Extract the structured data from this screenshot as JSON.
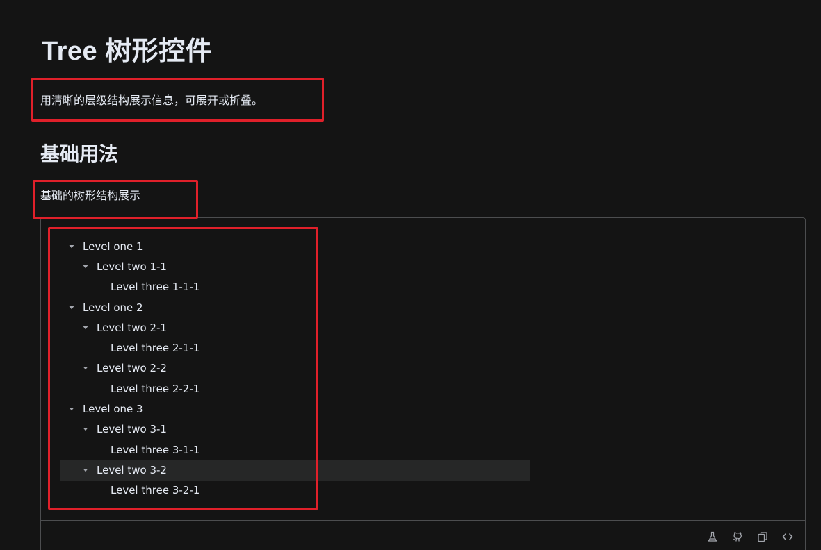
{
  "page": {
    "title": "Tree 树形控件",
    "description": "用清晰的层级结构展示信息，可展开或折叠。",
    "section_title": "基础用法",
    "section_description": "基础的树形结构展示"
  },
  "tree": {
    "nodes": [
      {
        "label": "Level one 1",
        "level": 1,
        "expanded": true
      },
      {
        "label": "Level two 1-1",
        "level": 2,
        "expanded": true
      },
      {
        "label": "Level three 1-1-1",
        "level": 3
      },
      {
        "label": "Level one 2",
        "level": 1,
        "expanded": true
      },
      {
        "label": "Level two 2-1",
        "level": 2,
        "expanded": true
      },
      {
        "label": "Level three 2-1-1",
        "level": 3
      },
      {
        "label": "Level two 2-2",
        "level": 2,
        "expanded": true
      },
      {
        "label": "Level three 2-2-1",
        "level": 3
      },
      {
        "label": "Level one 3",
        "level": 1,
        "expanded": true
      },
      {
        "label": "Level two 3-1",
        "level": 2,
        "expanded": true
      },
      {
        "label": "Level three 3-1-1",
        "level": 3
      },
      {
        "label": "Level two 3-2",
        "level": 2,
        "expanded": true,
        "hovered": true
      },
      {
        "label": "Level three 3-2-1",
        "level": 3
      }
    ]
  },
  "toolbar": {
    "icons": [
      "flask-icon",
      "github-icon",
      "copy-icon",
      "code-icon"
    ]
  },
  "colors": {
    "background": "#141414",
    "highlight": "#e0202a",
    "border": "#4c4d4f",
    "hover_row": "#262727"
  }
}
